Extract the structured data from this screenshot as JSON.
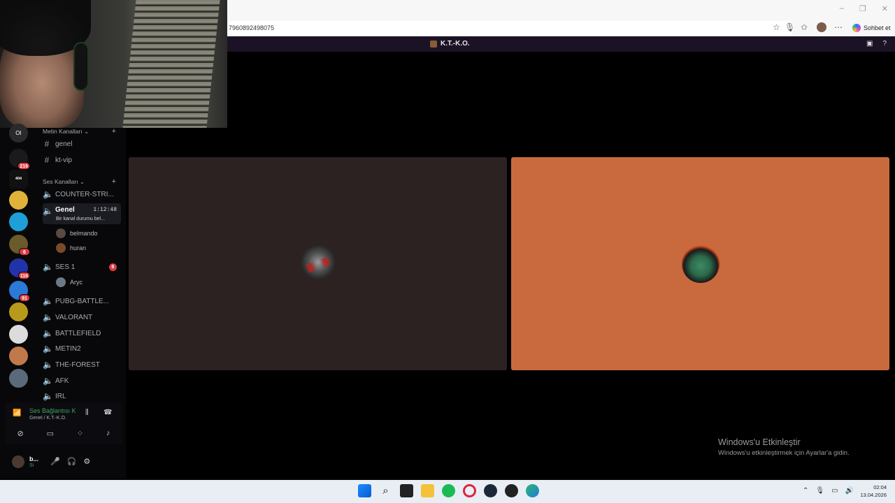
{
  "browser": {
    "url": "7960892498075",
    "window_controls": [
      "–",
      "❐",
      "✕"
    ],
    "chat_label": "Sohbet et"
  },
  "app_header": {
    "server_name": "K.T.-K.O."
  },
  "guilds": [
    {
      "label": "OI"
    },
    {
      "badge": "216"
    },
    {
      "label": "404 ERROR"
    },
    {
      "badge": ""
    },
    {
      "badge": ""
    },
    {
      "badge": "6"
    },
    {
      "badge": "116"
    },
    {
      "badge": "91"
    },
    {
      "badge": ""
    },
    {
      "badge": ""
    },
    {
      "badge": ""
    },
    {
      "badge": ""
    }
  ],
  "channels": {
    "text_category": "Metin Kanalları",
    "text_channels": [
      "genel",
      "kt-vip"
    ],
    "voice_category": "Ses Kanalları",
    "voice_channels": [
      {
        "name": "COUNTER-STRI..."
      },
      {
        "name": "Genel",
        "time": "1:12:48",
        "status": "Bir kanal durumu bel...",
        "users": [
          "belmando",
          "huran"
        ]
      },
      {
        "name": "SES 1",
        "badge": "6",
        "users": [
          "Aryc"
        ]
      },
      {
        "name": "PUBG-BATTLE..."
      },
      {
        "name": "VALORANT"
      },
      {
        "name": "BATTLEFIELD"
      },
      {
        "name": "METIN2"
      },
      {
        "name": "THE-FOREST"
      },
      {
        "name": "AFK"
      },
      {
        "name": "IRL"
      }
    ]
  },
  "voice_panel": {
    "title": "Ses Bağlantısı K",
    "subtitle": "Genel / K.T.-K.O."
  },
  "user_panel": {
    "name": "b...",
    "status": "Si"
  },
  "watermark": {
    "title": "Windows'u Etkinleştir",
    "subtitle": "Windows'u etkinleştirmek için Ayarlar'a gidin."
  },
  "clock": {
    "time": "02:04",
    "date": "13.04.2026"
  },
  "colors": {
    "tile_left": "#2c2222",
    "tile_right": "#c96a3e",
    "voice_connected": "#3ba55d",
    "badge": "#e03b40"
  }
}
